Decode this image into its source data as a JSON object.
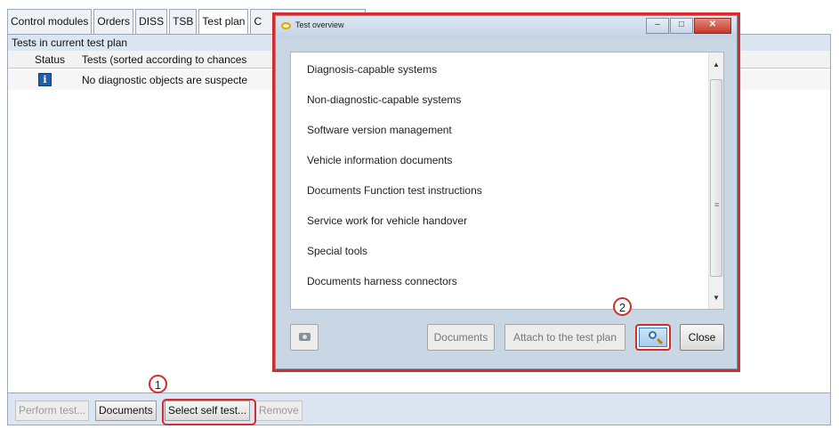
{
  "tabs": [
    {
      "label": "Control modules"
    },
    {
      "label": "Orders"
    },
    {
      "label": "DISS"
    },
    {
      "label": "TSB"
    },
    {
      "label": "Test plan"
    },
    {
      "label": "C"
    }
  ],
  "test_plan": {
    "section_title": "Tests in current test plan",
    "columns": {
      "status": "Status",
      "tests": "Tests (sorted according to chances"
    },
    "rows": [
      {
        "text": "No diagnostic objects are suspecte"
      }
    ]
  },
  "bottom_buttons": {
    "perform": "Perform test...",
    "documents": "Documents",
    "select_self": "Select self test...",
    "remove": "Remove"
  },
  "dialog": {
    "title": "Test overview",
    "items": [
      "Diagnosis-capable systems",
      "Non-diagnostic-capable systems",
      "Software version management",
      "Vehicle information documents",
      "Documents Function test instructions",
      "Service work for vehicle handover",
      "Special tools",
      "Documents harness connectors"
    ],
    "buttons": {
      "documents": "Documents",
      "attach": "Attach to the test plan",
      "close": "Close"
    }
  },
  "markers": {
    "one": "1",
    "two": "2"
  },
  "colors": {
    "highlight": "#d52b2b",
    "info": "#1f5faa"
  },
  "icons": {
    "info": "info-icon",
    "camera": "camera-icon",
    "search": "search-icon"
  }
}
